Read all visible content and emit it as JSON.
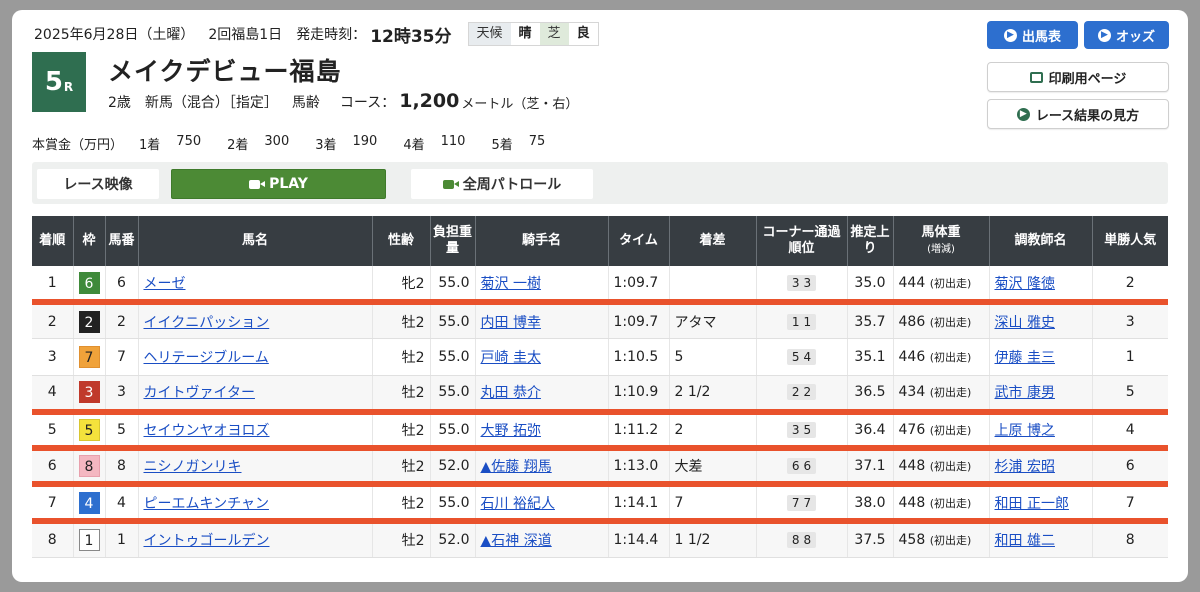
{
  "header": {
    "date": "2025年6月28日（土曜）",
    "meeting": "2回福島1日",
    "post_time_label": "発走時刻：",
    "post_time": "12時35分",
    "weather_label": "天候",
    "weather": "晴",
    "track_label": "芝",
    "track_condition": "良"
  },
  "race": {
    "number": "5",
    "suffix": "R",
    "name": "メイクデビュー福島",
    "age": "2歳",
    "class": "新馬（混合）［指定］",
    "weight_rule": "馬齢",
    "course_label": "コース：",
    "distance": "1,200",
    "distance_unit": "メートル（芝・右）"
  },
  "prize": {
    "label": "本賞金（万円）",
    "items": [
      {
        "place": "1着",
        "amount": "750"
      },
      {
        "place": "2着",
        "amount": "300"
      },
      {
        "place": "3着",
        "amount": "190"
      },
      {
        "place": "4着",
        "amount": "110"
      },
      {
        "place": "5着",
        "amount": "75"
      }
    ]
  },
  "buttons": {
    "entries": "出馬表",
    "odds": "オッズ",
    "print": "印刷用ページ",
    "howto": "レース結果の見方"
  },
  "video": {
    "race_video": "レース映像",
    "play": "PLAY",
    "patrol": "全周パトロール"
  },
  "table": {
    "headers": {
      "rank": "着順",
      "waku": "枠",
      "num": "馬番",
      "horse": "馬名",
      "sexage": "性齢",
      "weight": "負担重量",
      "jockey": "騎手名",
      "time": "タイム",
      "margin": "着差",
      "corner": "コーナー通過順位",
      "last3f": "推定上り",
      "body": "馬体重",
      "body_sub": "(増減)",
      "trainer": "調教師名",
      "pop": "単勝人気"
    },
    "rows": [
      {
        "rank": "1",
        "waku": "6",
        "num": "6",
        "horse": "メーゼ",
        "sexage": "牝2",
        "weight": "55.0",
        "jockey": "菊沢 一樹",
        "time": "1:09.7",
        "margin": "",
        "c1": "3",
        "c2": "3",
        "last3f": "35.0",
        "body": "444",
        "body_note": "(初出走)",
        "trainer": "菊沢 隆徳",
        "pop": "2"
      },
      {
        "rank": "2",
        "waku": "2",
        "num": "2",
        "horse": "イイクニパッション",
        "sexage": "牡2",
        "weight": "55.0",
        "jockey": "内田 博幸",
        "time": "1:09.7",
        "margin": "アタマ",
        "c1": "1",
        "c2": "1",
        "last3f": "35.7",
        "body": "486",
        "body_note": "(初出走)",
        "trainer": "深山 雅史",
        "pop": "3"
      },
      {
        "rank": "3",
        "waku": "7",
        "num": "7",
        "horse": "ヘリテージブルーム",
        "sexage": "牡2",
        "weight": "55.0",
        "jockey": "戸崎 圭太",
        "time": "1:10.5",
        "margin": "5",
        "c1": "5",
        "c2": "4",
        "last3f": "35.1",
        "body": "446",
        "body_note": "(初出走)",
        "trainer": "伊藤 圭三",
        "pop": "1"
      },
      {
        "rank": "4",
        "waku": "3",
        "num": "3",
        "horse": "カイトヴァイター",
        "sexage": "牡2",
        "weight": "55.0",
        "jockey": "丸田 恭介",
        "time": "1:10.9",
        "margin": "2 1/2",
        "c1": "2",
        "c2": "2",
        "last3f": "36.5",
        "body": "434",
        "body_note": "(初出走)",
        "trainer": "武市 康男",
        "pop": "5"
      },
      {
        "rank": "5",
        "waku": "5",
        "num": "5",
        "horse": "セイウンヤオヨロズ",
        "sexage": "牡2",
        "weight": "55.0",
        "jockey": "大野 拓弥",
        "time": "1:11.2",
        "margin": "2",
        "c1": "3",
        "c2": "5",
        "last3f": "36.4",
        "body": "476",
        "body_note": "(初出走)",
        "trainer": "上原 博之",
        "pop": "4"
      },
      {
        "rank": "6",
        "waku": "8",
        "num": "8",
        "horse": "ニシノガンリキ",
        "sexage": "牡2",
        "weight": "52.0",
        "jockey": "▲佐藤 翔馬",
        "time": "1:13.0",
        "margin": "大差",
        "c1": "6",
        "c2": "6",
        "last3f": "37.1",
        "body": "448",
        "body_note": "(初出走)",
        "trainer": "杉浦 宏昭",
        "pop": "6"
      },
      {
        "rank": "7",
        "waku": "4",
        "num": "4",
        "horse": "ピーエムキンチャン",
        "sexage": "牡2",
        "weight": "55.0",
        "jockey": "石川 裕紀人",
        "time": "1:14.1",
        "margin": "7",
        "c1": "7",
        "c2": "7",
        "last3f": "38.0",
        "body": "448",
        "body_note": "(初出走)",
        "trainer": "和田 正一郎",
        "pop": "7"
      },
      {
        "rank": "8",
        "waku": "1",
        "num": "1",
        "horse": "イントゥゴールデン",
        "sexage": "牡2",
        "weight": "52.0",
        "jockey": "▲石神 深道",
        "time": "1:14.4",
        "margin": "1 1/2",
        "c1": "8",
        "c2": "8",
        "last3f": "37.5",
        "body": "458",
        "body_note": "(初出走)",
        "trainer": "和田 雄二",
        "pop": "8"
      }
    ]
  },
  "waku_colors": {
    "1": {
      "bg": "#ffffff",
      "fg": "#222222",
      "border": "#888888"
    },
    "2": {
      "bg": "#222222",
      "fg": "#ffffff",
      "border": "#222222"
    },
    "3": {
      "bg": "#c0392b",
      "fg": "#ffffff",
      "border": "#c0392b"
    },
    "4": {
      "bg": "#2d6fcf",
      "fg": "#ffffff",
      "border": "#2d6fcf"
    },
    "5": {
      "bg": "#f4e23c",
      "fg": "#222222",
      "border": "#d8c630"
    },
    "6": {
      "bg": "#3f8a3a",
      "fg": "#ffffff",
      "border": "#3f8a3a"
    },
    "7": {
      "bg": "#f0a23a",
      "fg": "#222222",
      "border": "#e09030"
    },
    "8": {
      "bg": "#f4b7c1",
      "fg": "#222222",
      "border": "#e8a0ad"
    }
  },
  "colors": {
    "race_badge": "#2f6e50",
    "accent_blue": "#2d6fcf",
    "play_green": "#4c8a35",
    "separator_red": "#e9522c",
    "header_dark": "#373d42",
    "link_blue": "#1a4ec4"
  }
}
